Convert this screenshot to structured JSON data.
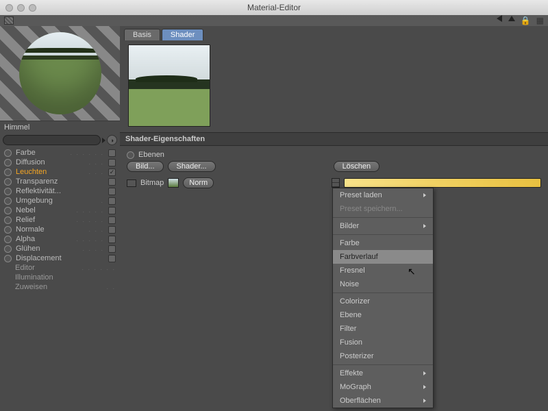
{
  "window": {
    "title": "Material-Editor"
  },
  "material": {
    "name": "Himmel"
  },
  "tabs": {
    "basis": "Basis",
    "shader": "Shader"
  },
  "channels": [
    {
      "label": "Farbe",
      "active": false,
      "checked": false,
      "showCheck": true
    },
    {
      "label": "Diffusion",
      "active": false,
      "checked": false,
      "showCheck": true
    },
    {
      "label": "Leuchten",
      "active": true,
      "checked": true,
      "showCheck": true
    },
    {
      "label": "Transparenz",
      "active": false,
      "checked": false,
      "showCheck": true
    },
    {
      "label": "Reflektivität...",
      "active": false,
      "checked": false,
      "showCheck": true
    },
    {
      "label": "Umgebung",
      "active": false,
      "checked": false,
      "showCheck": true
    },
    {
      "label": "Nebel",
      "active": false,
      "checked": false,
      "showCheck": true
    },
    {
      "label": "Relief",
      "active": false,
      "checked": false,
      "showCheck": true
    },
    {
      "label": "Normale",
      "active": false,
      "checked": false,
      "showCheck": true
    },
    {
      "label": "Alpha",
      "active": false,
      "checked": false,
      "showCheck": true
    },
    {
      "label": "Glühen",
      "active": false,
      "checked": false,
      "showCheck": true
    },
    {
      "label": "Displacement",
      "active": false,
      "checked": false,
      "showCheck": true
    }
  ],
  "channel_subitems": [
    {
      "label": "Editor"
    },
    {
      "label": "Illumination"
    },
    {
      "label": "Zuweisen"
    }
  ],
  "section": {
    "header": "Shader-Eigenschaften",
    "ebenen": "Ebenen"
  },
  "buttons": {
    "bild": "Bild...",
    "shader": "Shader...",
    "loeschen": "Löschen",
    "normal_truncated": "Norm"
  },
  "layer": {
    "type": "Bitmap"
  },
  "menu": {
    "preset_load": "Preset laden",
    "preset_save": "Preset speichern...",
    "bilder": "Bilder",
    "farbe": "Farbe",
    "farbverlauf": "Farbverlauf",
    "fresnel": "Fresnel",
    "noise": "Noise",
    "colorizer": "Colorizer",
    "ebene": "Ebene",
    "filter": "Filter",
    "fusion": "Fusion",
    "posterizer": "Posterizer",
    "effekte": "Effekte",
    "mograph": "MoGraph",
    "oberflaechen": "Oberflächen"
  }
}
